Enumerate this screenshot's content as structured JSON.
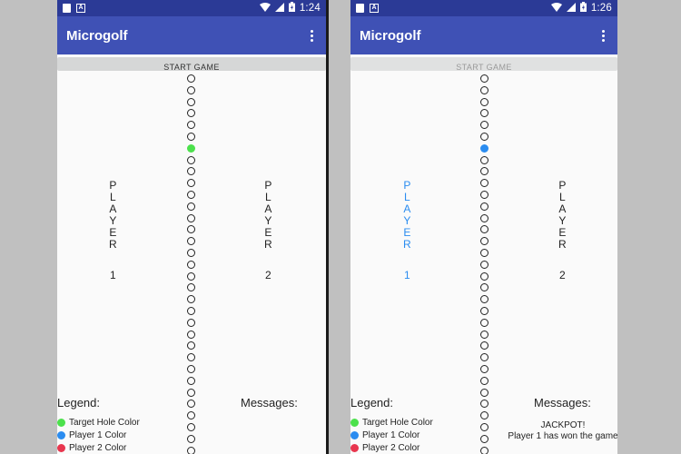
{
  "colors": {
    "target": "#4ce14c",
    "player1": "#2a8cf0",
    "player2": "#e8364e",
    "appbar": "#3f51b5",
    "statusbar": "#2b3a96"
  },
  "screens": [
    {
      "status_time": "1:24",
      "app_title": "Microgolf",
      "start_button": "START GAME",
      "player1": {
        "letters": [
          "P",
          "L",
          "A",
          "Y",
          "E",
          "R"
        ],
        "number": "1"
      },
      "player2": {
        "letters": [
          "P",
          "L",
          "A",
          "Y",
          "E",
          "R"
        ],
        "number": "2"
      },
      "highlight_index": 6,
      "highlight_color": "target",
      "legend_title": "Legend:",
      "legend_items": [
        "Target Hole Color",
        "Player 1 Color",
        "Player 2 Color"
      ],
      "messages_title": "Messages:",
      "messages": []
    },
    {
      "status_time": "1:26",
      "app_title": "Microgolf",
      "start_button": "START GAME",
      "player1": {
        "letters": [
          "P",
          "L",
          "A",
          "Y",
          "E",
          "R"
        ],
        "number": "1"
      },
      "player2": {
        "letters": [
          "P",
          "L",
          "A",
          "Y",
          "E",
          "R"
        ],
        "number": "2"
      },
      "highlight_index": 6,
      "highlight_color": "player1",
      "legend_title": "Legend:",
      "legend_items": [
        "Target Hole Color",
        "Player 1 Color",
        "Player 2 Color"
      ],
      "messages_title": "Messages:",
      "messages": [
        "JACKPOT!",
        "Player 1 has won the game"
      ]
    }
  ],
  "hole_count": 33
}
